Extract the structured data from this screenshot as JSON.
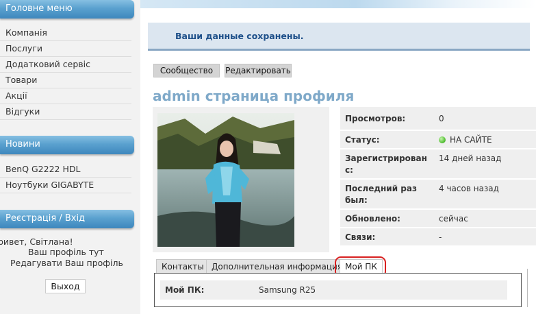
{
  "sidebar": {
    "main_menu": {
      "title": "Головне меню",
      "items": [
        "Компанія",
        "Послуги",
        "Додатковий сервіс",
        "Товари",
        "Акції",
        "Відгуки"
      ]
    },
    "news": {
      "title": "Новини",
      "items": [
        "BenQ G2222 HDL",
        "Ноутбуки GIGABYTE"
      ]
    },
    "auth": {
      "title": "Реєстрація / Вхід",
      "greeting": "ривет, Світлана!",
      "profile_link": "Ваш профіль тут",
      "edit_link": "Редагувати Ваш профіль",
      "logout": "Выход"
    }
  },
  "main": {
    "notice": "Ваши данные сохранены.",
    "buttons": {
      "community": "Сообщество",
      "edit": "Редактировать"
    },
    "profile_title": "admin страница профиля",
    "info": [
      {
        "label": "Просмотров:",
        "value": "0"
      },
      {
        "label": "Статус:",
        "value": "НА САЙТЕ",
        "status_color": "#3c9a34"
      },
      {
        "label": "Зарегистрирован с:",
        "value": "14 дней назад"
      },
      {
        "label": "Последний раз был:",
        "value": "4 часов назад"
      },
      {
        "label": "Обновлено:",
        "value": "сейчас"
      },
      {
        "label": "Связи:",
        "value": "-"
      }
    ],
    "tabs": [
      "Контакты",
      "Дополнительная информация",
      "Мой ПК"
    ],
    "active_tab": "Мой ПК",
    "pc": {
      "label": "Мой ПК:",
      "value": "Samsung R25"
    }
  },
  "colors": {
    "sidebar_header": "#5aa1cf",
    "notice_text": "#1d4f89",
    "title": "#7fa9c9",
    "highlight": "#d81f1f"
  }
}
